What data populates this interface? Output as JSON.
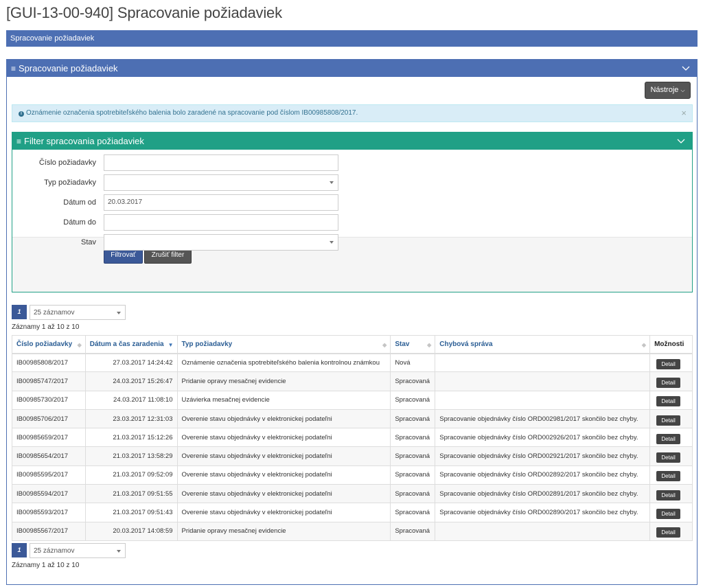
{
  "page": {
    "title": "[GUI-13-00-940] Spracovanie požiadaviek",
    "breadcrumb": "Spracovanie požiadaviek"
  },
  "main_panel": {
    "title": "Spracovanie požiadaviek",
    "tools_button": "Nástroje"
  },
  "alert": {
    "message": "Oznámenie označenia spotrebiteľského balenia bolo zaradené na spracovanie pod číslom IB00985808/2017."
  },
  "filter": {
    "title": "Filter spracovania požiadaviek",
    "fields": {
      "request_number": {
        "label": "Číslo požiadavky",
        "value": ""
      },
      "request_type": {
        "label": "Typ požiadavky",
        "value": ""
      },
      "date_from": {
        "label": "Dátum od",
        "value": "20.03.2017"
      },
      "date_to": {
        "label": "Dátum do",
        "value": ""
      },
      "status": {
        "label": "Stav",
        "value": ""
      }
    },
    "filter_button": "Filtrovať",
    "clear_button": "Zrušiť filter"
  },
  "pager": {
    "page": "1",
    "page_size": "25 záznamov",
    "records_info": "Záznamy 1 až 10 z 10"
  },
  "table": {
    "columns": {
      "number": "Číslo požiadavky",
      "datetime": "Dátum a čas zaradenia",
      "type": "Typ požiadavky",
      "status": "Stav",
      "error": "Chybová správa",
      "options": "Možnosti"
    },
    "detail_label": "Detail",
    "rows": [
      {
        "number": "IB00985808/2017",
        "datetime": "27.03.2017 14:24:42",
        "type": "Oznámenie označenia spotrebiteľského balenia kontrolnou známkou",
        "status": "Nová",
        "error": ""
      },
      {
        "number": "IB00985747/2017",
        "datetime": "24.03.2017 15:26:47",
        "type": "Pridanie opravy mesačnej evidencie",
        "status": "Spracovaná",
        "error": ""
      },
      {
        "number": "IB00985730/2017",
        "datetime": "24.03.2017 11:08:10",
        "type": "Uzávierka mesačnej evidencie",
        "status": "Spracovaná",
        "error": ""
      },
      {
        "number": "IB00985706/2017",
        "datetime": "23.03.2017 12:31:03",
        "type": "Overenie stavu objednávky v elektronickej podateľni",
        "status": "Spracovaná",
        "error": "Spracovanie objednávky číslo ORD002981/2017 skončilo bez chyby."
      },
      {
        "number": "IB00985659/2017",
        "datetime": "21.03.2017 15:12:26",
        "type": "Overenie stavu objednávky v elektronickej podateľni",
        "status": "Spracovaná",
        "error": "Spracovanie objednávky číslo ORD002926/2017 skončilo bez chyby."
      },
      {
        "number": "IB00985654/2017",
        "datetime": "21.03.2017 13:58:29",
        "type": "Overenie stavu objednávky v elektronickej podateľni",
        "status": "Spracovaná",
        "error": "Spracovanie objednávky číslo ORD002921/2017 skončilo bez chyby."
      },
      {
        "number": "IB00985595/2017",
        "datetime": "21.03.2017 09:52:09",
        "type": "Overenie stavu objednávky v elektronickej podateľni",
        "status": "Spracovaná",
        "error": "Spracovanie objednávky číslo ORD002892/2017 skončilo bez chyby."
      },
      {
        "number": "IB00985594/2017",
        "datetime": "21.03.2017 09:51:55",
        "type": "Overenie stavu objednávky v elektronickej podateľni",
        "status": "Spracovaná",
        "error": "Spracovanie objednávky číslo ORD002891/2017 skončilo bez chyby."
      },
      {
        "number": "IB00985593/2017",
        "datetime": "21.03.2017 09:51:43",
        "type": "Overenie stavu objednávky v elektronickej podateľni",
        "status": "Spracovaná",
        "error": "Spracovanie objednávky číslo ORD002890/2017 skončilo bez chyby."
      },
      {
        "number": "IB00985567/2017",
        "datetime": "20.03.2017 14:08:59",
        "type": "Pridanie opravy mesačnej evidencie",
        "status": "Spracovaná",
        "error": ""
      }
    ]
  },
  "icons": {
    "menu": "hamburger-icon",
    "collapse": "chevron-down-icon",
    "info": "info-icon",
    "close": "close-icon",
    "sort": "sort-icon"
  },
  "colors": {
    "primary": "#4d6fb3",
    "filter_accent": "#20a086",
    "button_dark": "#555555",
    "button_primary": "#3b5998",
    "alert_bg": "#d9edf7"
  }
}
